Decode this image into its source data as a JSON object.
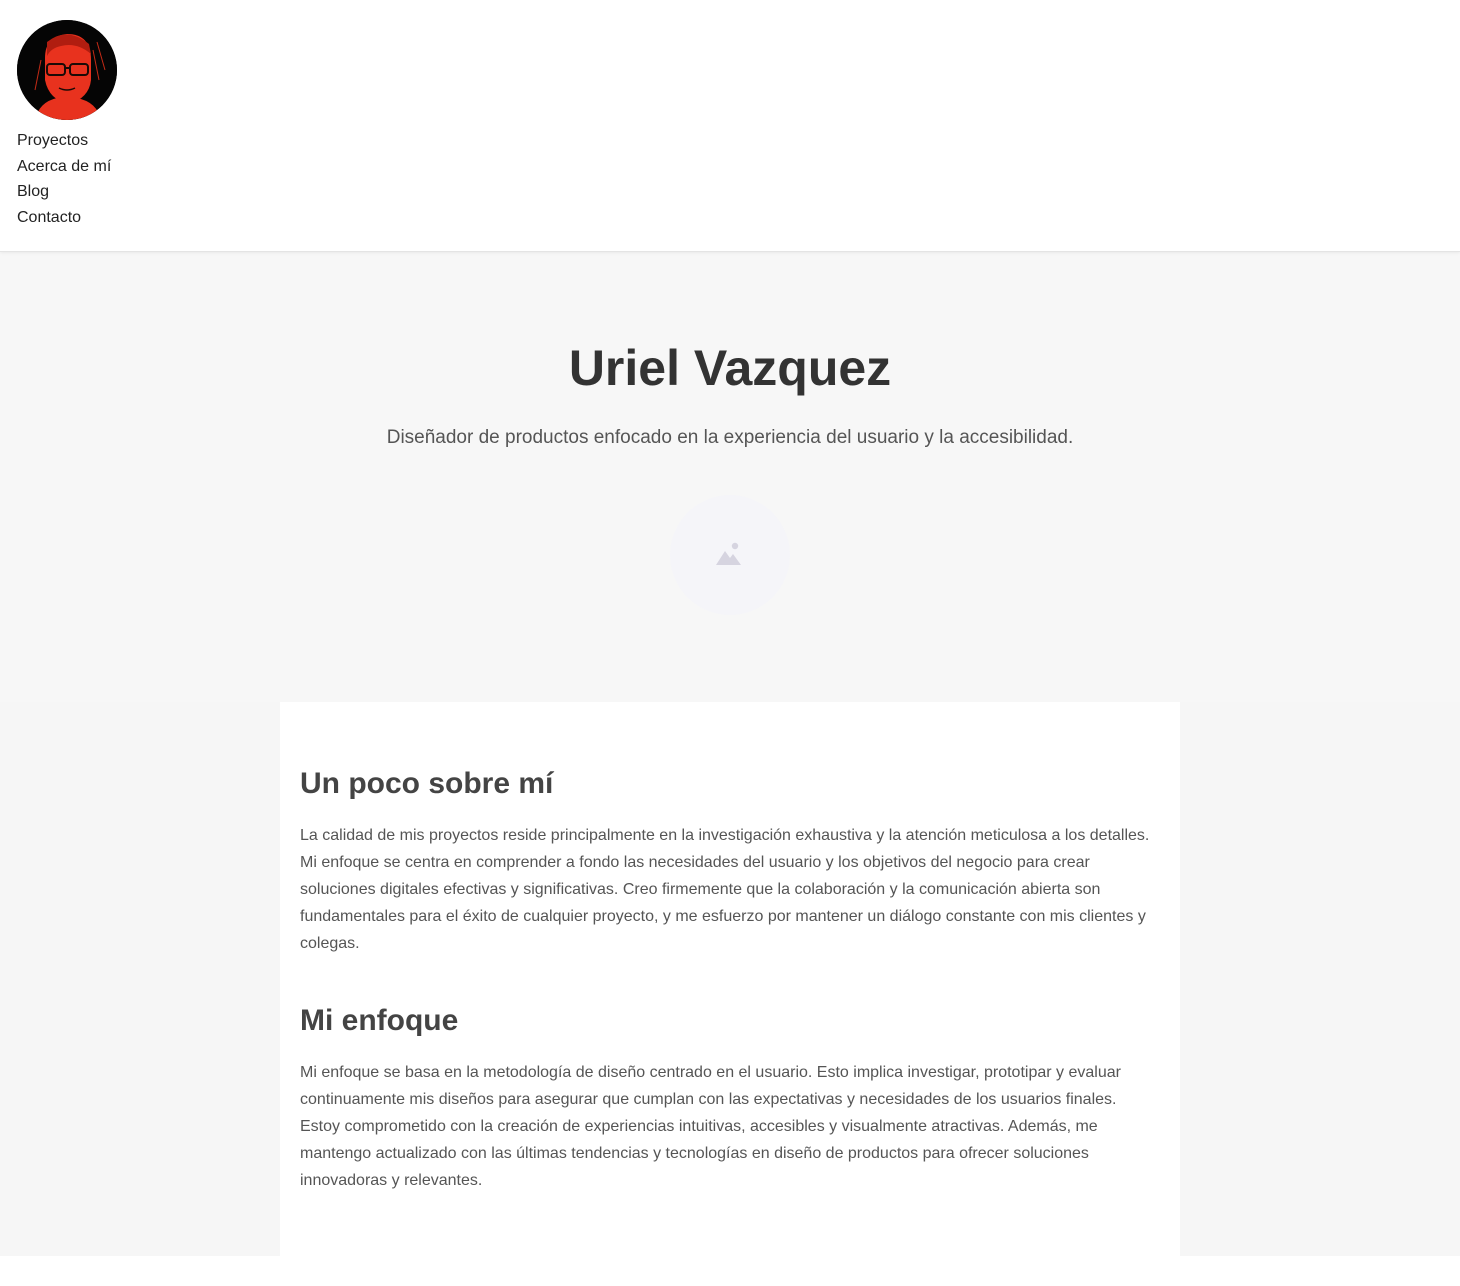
{
  "header": {
    "nav": [
      "Proyectos",
      "Acerca de mí",
      "Blog",
      "Contacto"
    ]
  },
  "hero": {
    "title": "Uriel Vazquez",
    "subtitle": "Diseñador de productos enfocado en la experiencia del usuario y la accesibilidad."
  },
  "about": {
    "title": "Un poco sobre mí",
    "text": "La calidad de mis proyectos reside principalmente en la investigación exhaustiva y la atención meticulosa a los detalles. Mi enfoque se centra en comprender a fondo las necesidades del usuario y los objetivos del negocio para crear soluciones digitales efectivas y significativas. Creo firmemente que la colaboración y la comunicación abierta son fundamentales para el éxito de cualquier proyecto, y me esfuerzo por mantener un diálogo constante con mis clientes y colegas."
  },
  "approach": {
    "title": "Mi enfoque",
    "text": "Mi enfoque se basa en la metodología de diseño centrado en el usuario. Esto implica investigar, prototipar y evaluar continuamente mis diseños para asegurar que cumplan con las expectativas y necesidades de los usuarios finales. Estoy comprometido con la creación de experiencias intuitivas, accesibles y visualmente atractivas. Además, me mantengo actualizado con las últimas tendencias y tecnologías en diseño de productos para ofrecer soluciones innovadoras y relevantes."
  },
  "icons": {
    "avatar": "avatar-portrait",
    "hero_image": "image-placeholder-icon"
  },
  "colors": {
    "header_bg": "#ffffff",
    "hero_bg": "#f7f7f7",
    "content_bg": "#ffffff",
    "avatar_accent": "#e8321e"
  }
}
